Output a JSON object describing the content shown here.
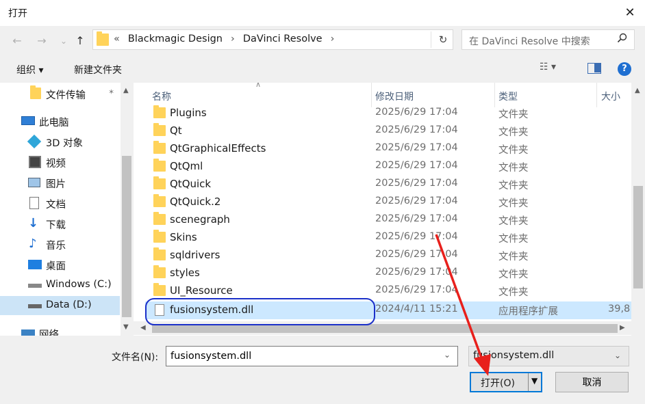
{
  "window": {
    "title": "打开",
    "close_glyph": "✕"
  },
  "nav": {
    "back": "←",
    "forward": "→",
    "recent": "⌄",
    "up": "↑",
    "breadcrumb": [
      "«",
      "Blackmagic Design",
      "›",
      "DaVinci Resolve",
      "›"
    ],
    "refresh": "↻",
    "search_placeholder": "在 DaVinci Resolve 中搜索"
  },
  "toolbar": {
    "organize": "组织 ▾",
    "new_folder": "新建文件夹",
    "view": "☷ ▾",
    "help": "?"
  },
  "sidebar": {
    "items": [
      {
        "label": "文件传输",
        "icon": "folder-icon",
        "pin": "📌"
      },
      {
        "label": "此电脑",
        "icon": "computer-icon"
      },
      {
        "label": "3D 对象",
        "icon": "3d-objects-icon"
      },
      {
        "label": "视频",
        "icon": "video-icon"
      },
      {
        "label": "图片",
        "icon": "pictures-icon"
      },
      {
        "label": "文档",
        "icon": "documents-icon"
      },
      {
        "label": "下载",
        "icon": "download-icon"
      },
      {
        "label": "音乐",
        "icon": "music-icon"
      },
      {
        "label": "桌面",
        "icon": "desktop-icon"
      },
      {
        "label": "Windows (C:)",
        "icon": "drive-icon"
      },
      {
        "label": "Data (D:)",
        "icon": "drive-icon"
      },
      {
        "label": "网络",
        "icon": "network-icon"
      }
    ]
  },
  "list": {
    "columns": {
      "name": "名称",
      "date": "修改日期",
      "type": "类型",
      "size": "大小"
    },
    "rows": [
      {
        "name": "Plugins",
        "date": "2025/6/29 17:04",
        "type": "文件夹",
        "size": ""
      },
      {
        "name": "Qt",
        "date": "2025/6/29 17:04",
        "type": "文件夹",
        "size": ""
      },
      {
        "name": "QtGraphicalEffects",
        "date": "2025/6/29 17:04",
        "type": "文件夹",
        "size": ""
      },
      {
        "name": "QtQml",
        "date": "2025/6/29 17:04",
        "type": "文件夹",
        "size": ""
      },
      {
        "name": "QtQuick",
        "date": "2025/6/29 17:04",
        "type": "文件夹",
        "size": ""
      },
      {
        "name": "QtQuick.2",
        "date": "2025/6/29 17:04",
        "type": "文件夹",
        "size": ""
      },
      {
        "name": "scenegraph",
        "date": "2025/6/29 17:04",
        "type": "文件夹",
        "size": ""
      },
      {
        "name": "Skins",
        "date": "2025/6/29 17:04",
        "type": "文件夹",
        "size": ""
      },
      {
        "name": "sqldrivers",
        "date": "2025/6/29 17:04",
        "type": "文件夹",
        "size": ""
      },
      {
        "name": "styles",
        "date": "2025/6/29 17:04",
        "type": "文件夹",
        "size": ""
      },
      {
        "name": "UI_Resource",
        "date": "2025/6/29 17:04",
        "type": "文件夹",
        "size": ""
      },
      {
        "name": "fusionsystem.dll",
        "date": "2024/4/11 15:21",
        "type": "应用程序扩展",
        "size": "39,8"
      }
    ]
  },
  "bottom": {
    "filename_label": "文件名(N):",
    "filename_value": "fusionsystem.dll",
    "filter_value": "fusionsystem.dll",
    "open_label": "打开(O)",
    "cancel_label": "取消"
  },
  "colors": {
    "selection": "#cce8ff",
    "highlight_circle": "#1a2fc9",
    "annotation_arrow": "#e8201c",
    "accent": "#0078d7"
  }
}
